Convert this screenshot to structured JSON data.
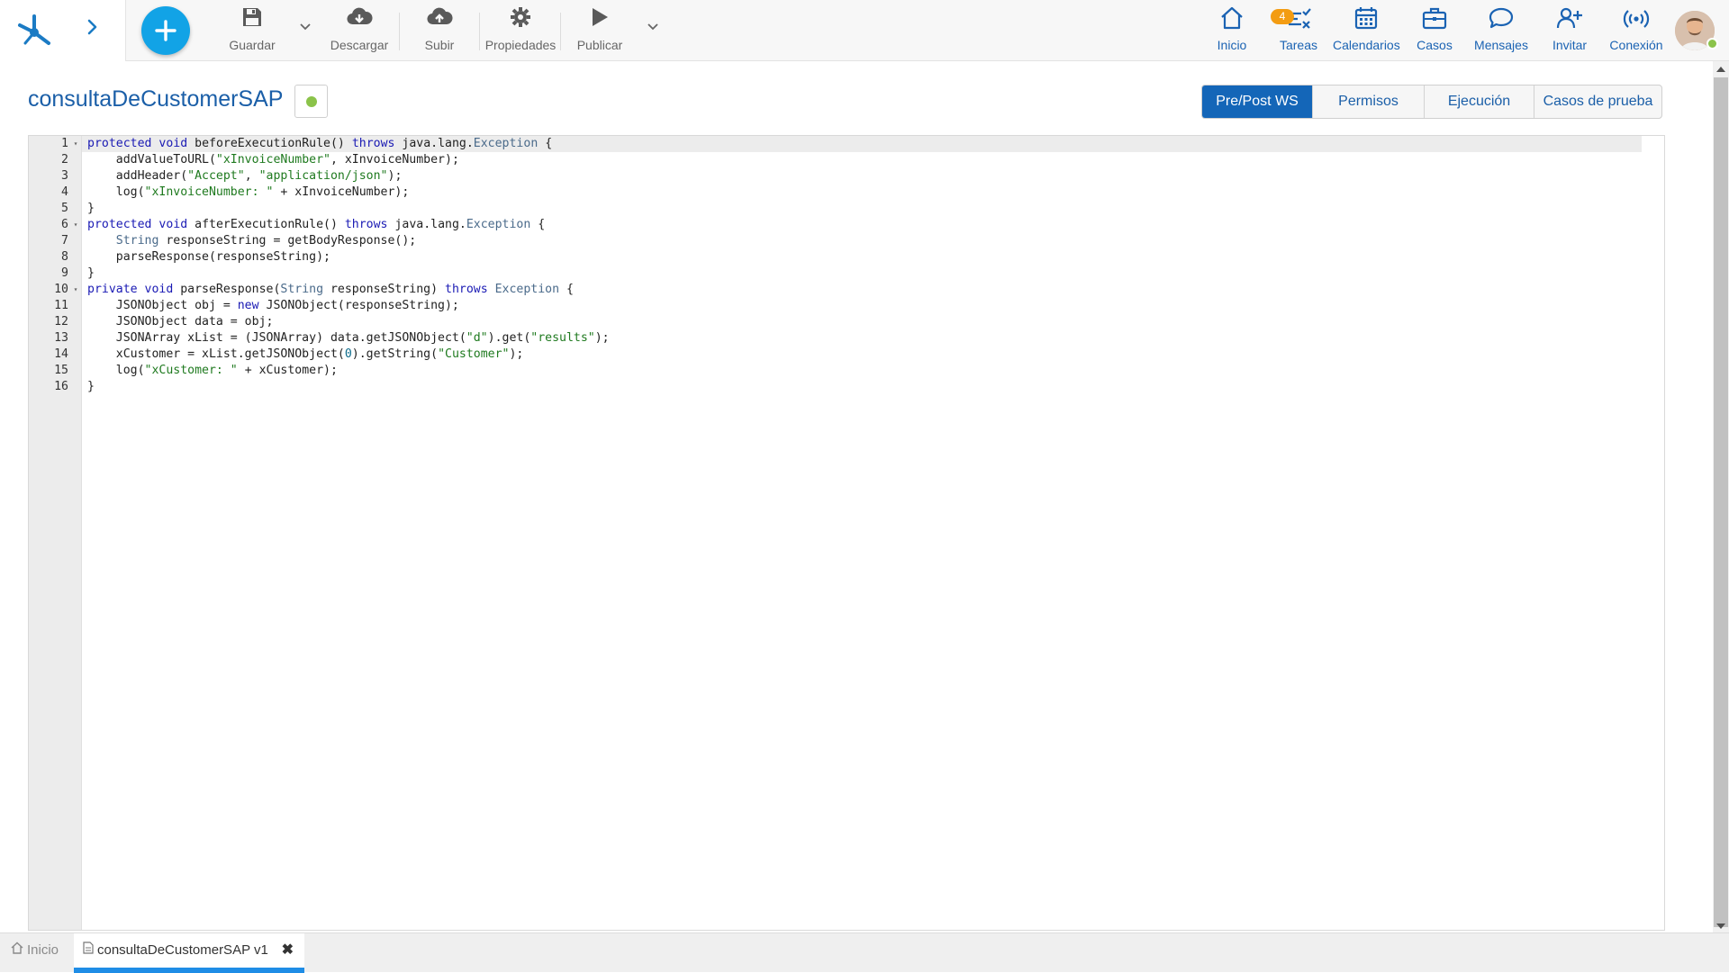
{
  "toolbar": {
    "save_label": "Guardar",
    "download_label": "Descargar",
    "upload_label": "Subir",
    "properties_label": "Propiedades",
    "publish_label": "Publicar"
  },
  "nav": {
    "home_label": "Inicio",
    "tasks_label": "Tareas",
    "tasks_badge": "4",
    "calendars_label": "Calendarios",
    "cases_label": "Casos",
    "messages_label": "Mensajes",
    "invite_label": "Invitar",
    "connection_label": "Conexión"
  },
  "page": {
    "title": "consultaDeCustomerSAP"
  },
  "tabs": [
    {
      "label": "Pre/Post WS",
      "active": true
    },
    {
      "label": "Permisos",
      "active": false
    },
    {
      "label": "Ejecución",
      "active": false
    },
    {
      "label": "Casos de prueba",
      "active": false
    }
  ],
  "editor": {
    "lines": [
      {
        "n": "1",
        "fold": true,
        "code": "protected void beforeExecutionRule() throws java.lang.Exception {"
      },
      {
        "n": "2",
        "fold": false,
        "code": "    addValueToURL(\"xInvoiceNumber\", xInvoiceNumber);"
      },
      {
        "n": "3",
        "fold": false,
        "code": "    addHeader(\"Accept\", \"application/json\");"
      },
      {
        "n": "4",
        "fold": false,
        "code": "    log(\"xInvoiceNumber: \" + xInvoiceNumber);"
      },
      {
        "n": "5",
        "fold": false,
        "code": "}"
      },
      {
        "n": "6",
        "fold": true,
        "code": "protected void afterExecutionRule() throws java.lang.Exception {"
      },
      {
        "n": "7",
        "fold": false,
        "code": "    String responseString = getBodyResponse();"
      },
      {
        "n": "8",
        "fold": false,
        "code": "    parseResponse(responseString);"
      },
      {
        "n": "9",
        "fold": false,
        "code": "}"
      },
      {
        "n": "10",
        "fold": true,
        "code": "private void parseResponse(String responseString) throws Exception {"
      },
      {
        "n": "11",
        "fold": false,
        "code": "    JSONObject obj = new JSONObject(responseString);"
      },
      {
        "n": "12",
        "fold": false,
        "code": "    JSONObject data = obj;"
      },
      {
        "n": "13",
        "fold": false,
        "code": "    JSONArray xList = (JSONArray) data.getJSONObject(\"d\").get(\"results\");"
      },
      {
        "n": "14",
        "fold": false,
        "code": "    xCustomer = xList.getJSONObject(0).getString(\"Customer\");"
      },
      {
        "n": "15",
        "fold": false,
        "code": "    log(\"xCustomer: \" + xCustomer);"
      },
      {
        "n": "16",
        "fold": false,
        "code": "}"
      }
    ]
  },
  "bottom_tabs": {
    "home_label": "Inicio",
    "current_label": "consultaDeCustomerSAP v1",
    "close_symbol": "✖"
  },
  "colors": {
    "accent": "#1466b8",
    "fab": "#12a3e6",
    "status_dot": "#8bc34a",
    "badge": "#f39c12",
    "bottom_tab_underline": "#1f8de6"
  },
  "icons": {
    "logo": "tree-logo-icon",
    "expand": "chevron-right-icon",
    "fab": "plus-icon",
    "save": "floppy-icon",
    "download": "cloud-download-icon",
    "upload": "cloud-upload-icon",
    "properties": "gear-icon",
    "publish": "play-icon",
    "home": "house-icon",
    "tasks": "checklist-icon",
    "calendars": "calendar-icon",
    "cases": "briefcase-icon",
    "messages": "chat-bubble-icon",
    "invite": "add-user-icon",
    "connection": "wireless-icon"
  }
}
